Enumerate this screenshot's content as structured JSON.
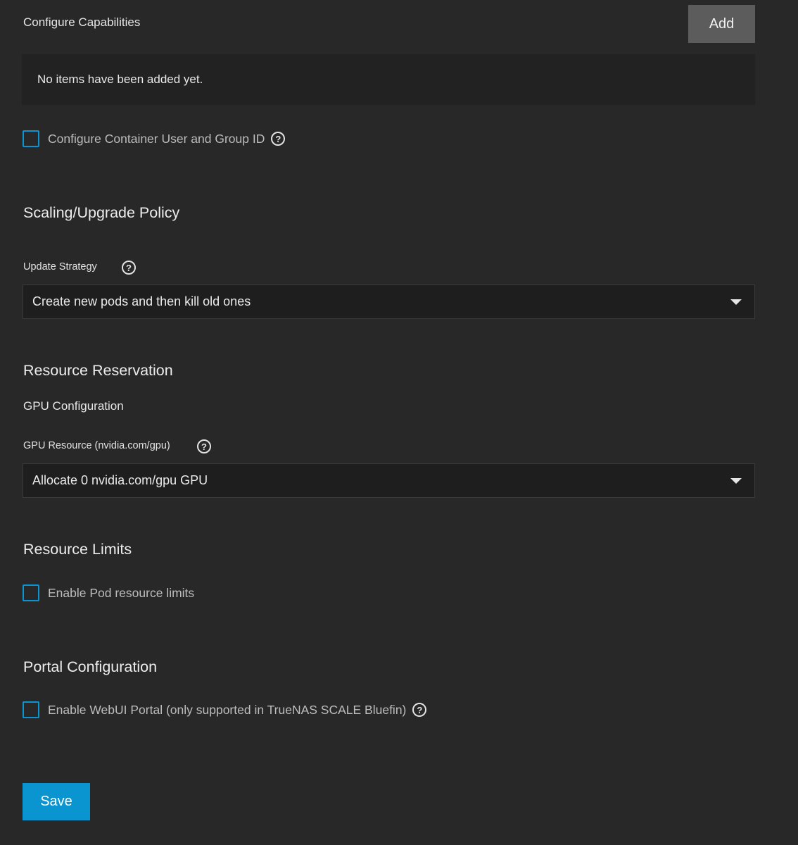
{
  "capabilities": {
    "title": "Configure Capabilities",
    "add_label": "Add",
    "empty_text": "No items have been added yet."
  },
  "user_group": {
    "label": "Configure Container User and Group ID",
    "checked": false
  },
  "scaling": {
    "title": "Scaling/Upgrade Policy",
    "update_strategy_label": "Update Strategy",
    "update_strategy_value": "Create new pods and then kill old ones"
  },
  "reservation": {
    "title": "Resource Reservation",
    "gpu_config_title": "GPU Configuration",
    "gpu_resource_label": "GPU Resource (nvidia.com/gpu)",
    "gpu_resource_value": "Allocate 0 nvidia.com/gpu GPU"
  },
  "limits": {
    "title": "Resource Limits",
    "enable_label": "Enable Pod resource limits",
    "checked": false
  },
  "portal": {
    "title": "Portal Configuration",
    "enable_label": "Enable WebUI Portal (only supported in TrueNAS SCALE Bluefin)",
    "checked": false
  },
  "actions": {
    "save_label": "Save"
  },
  "help_glyph": "?",
  "colors": {
    "background": "#282828",
    "accent": "#0a95d1",
    "add_button": "#5c5c5c",
    "select_bg": "#1e1e1e"
  }
}
